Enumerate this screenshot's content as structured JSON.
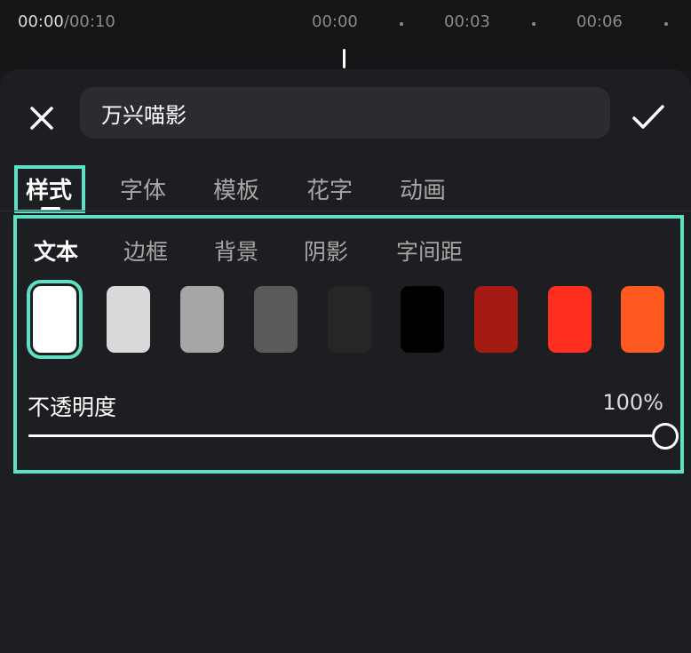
{
  "timeline": {
    "current_time": "00:00",
    "total_time": "/00:10",
    "marks": [
      "00:00",
      "00:03",
      "00:06"
    ]
  },
  "editor": {
    "text_value": "万兴喵影",
    "close_icon": "close-icon",
    "confirm_icon": "checkmark-icon"
  },
  "tabs": [
    {
      "label": "样式",
      "active": true
    },
    {
      "label": "字体",
      "active": false
    },
    {
      "label": "模板",
      "active": false
    },
    {
      "label": "花字",
      "active": false
    },
    {
      "label": "动画",
      "active": false
    }
  ],
  "subtabs": [
    {
      "label": "文本",
      "active": true
    },
    {
      "label": "边框",
      "active": false
    },
    {
      "label": "背景",
      "active": false
    },
    {
      "label": "阴影",
      "active": false
    },
    {
      "label": "字间距",
      "active": false
    }
  ],
  "swatches": [
    {
      "color": "#ffffff",
      "selected": true
    },
    {
      "color": "#d9d9d9",
      "selected": false
    },
    {
      "color": "#a6a6a6",
      "selected": false
    },
    {
      "color": "#5a5a5a",
      "selected": false
    },
    {
      "color": "#262626",
      "selected": false
    },
    {
      "color": "#000000",
      "selected": false
    },
    {
      "color": "#a51a12",
      "selected": false
    },
    {
      "color": "#ff2e1f",
      "selected": false
    },
    {
      "color": "#ff5a1f",
      "selected": false
    }
  ],
  "opacity": {
    "label": "不透明度",
    "value_text": "100%",
    "value": 1.0
  },
  "colors": {
    "accent": "#5ee0c4",
    "panel_bg": "#1c1e21"
  }
}
